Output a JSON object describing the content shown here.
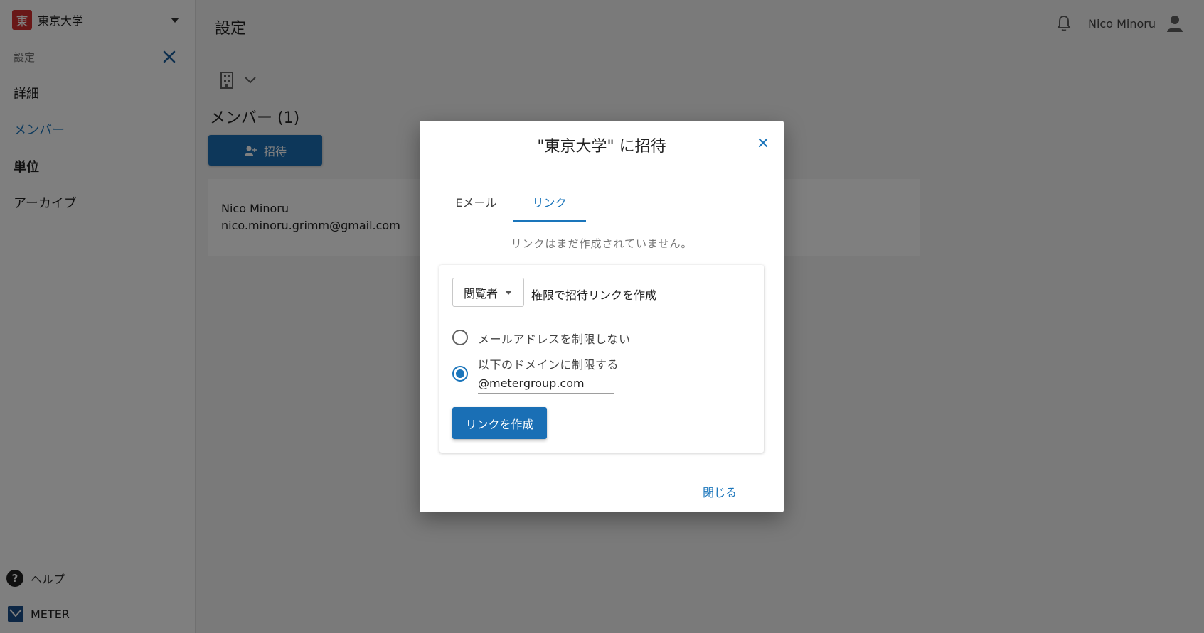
{
  "sidebar": {
    "org_logo_char": "東",
    "org_name": "東京大学",
    "section_label": "設定",
    "items": [
      {
        "label": "詳細"
      },
      {
        "label": "メンバー"
      },
      {
        "label": "単位"
      },
      {
        "label": "アーカイブ"
      }
    ],
    "help_label": "ヘルプ",
    "brand_label": "METER"
  },
  "header": {
    "title": "設定",
    "user_name": "Nico Minoru"
  },
  "main": {
    "members_title": "メンバー (1)",
    "invite_label": "招待",
    "member": {
      "name": "Nico Minoru",
      "email": "nico.minoru.grimm@gmail.com"
    }
  },
  "dialog": {
    "title": "\"東京大学\" に招待",
    "tabs": [
      {
        "label": "Eメール"
      },
      {
        "label": "リンク"
      }
    ],
    "note": "リンクはまだ作成されていません。",
    "role_value": "閲覧者",
    "role_suffix": "権限で招待リンクを作成",
    "option_unrestricted": "メールアドレスを制限しない",
    "option_domain": "以下のドメインに制限する",
    "domain_value": "@metergroup.com",
    "create_label": "リンクを作成",
    "close_label": "閉じる"
  },
  "colors": {
    "accent": "#1a75bb",
    "button": "#1a6fb5",
    "org_logo": "#d32f2f"
  }
}
